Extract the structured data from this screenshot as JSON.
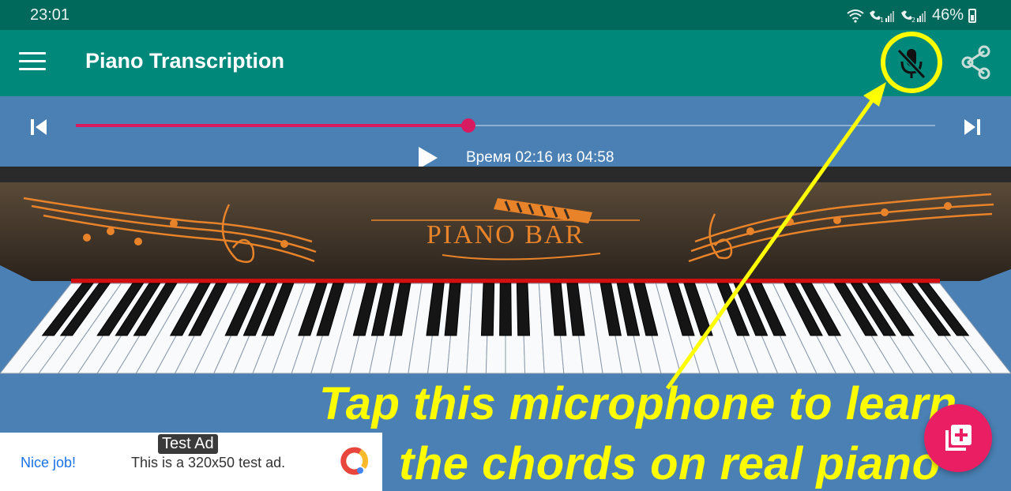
{
  "status_bar": {
    "time": "23:01",
    "battery": "46%"
  },
  "app_bar": {
    "title": "Piano Transcription"
  },
  "player": {
    "progress_fraction": 0.457,
    "time_text": "Время 02:16 из 04:58"
  },
  "piano": {
    "brand": "PIANO BAR"
  },
  "ad": {
    "badge": "Test Ad",
    "cta": "Nice job!",
    "text": "This is a 320x50 test ad."
  },
  "annotation": {
    "line1": "Tap this microphone to learn",
    "line2": "the chords on real piano",
    "color": "#ffff00"
  },
  "colors": {
    "app_bar": "#00897b",
    "status_bar": "#00695c",
    "background": "#4a80b4",
    "accent": "#d81b60",
    "fab": "#e91e63"
  }
}
